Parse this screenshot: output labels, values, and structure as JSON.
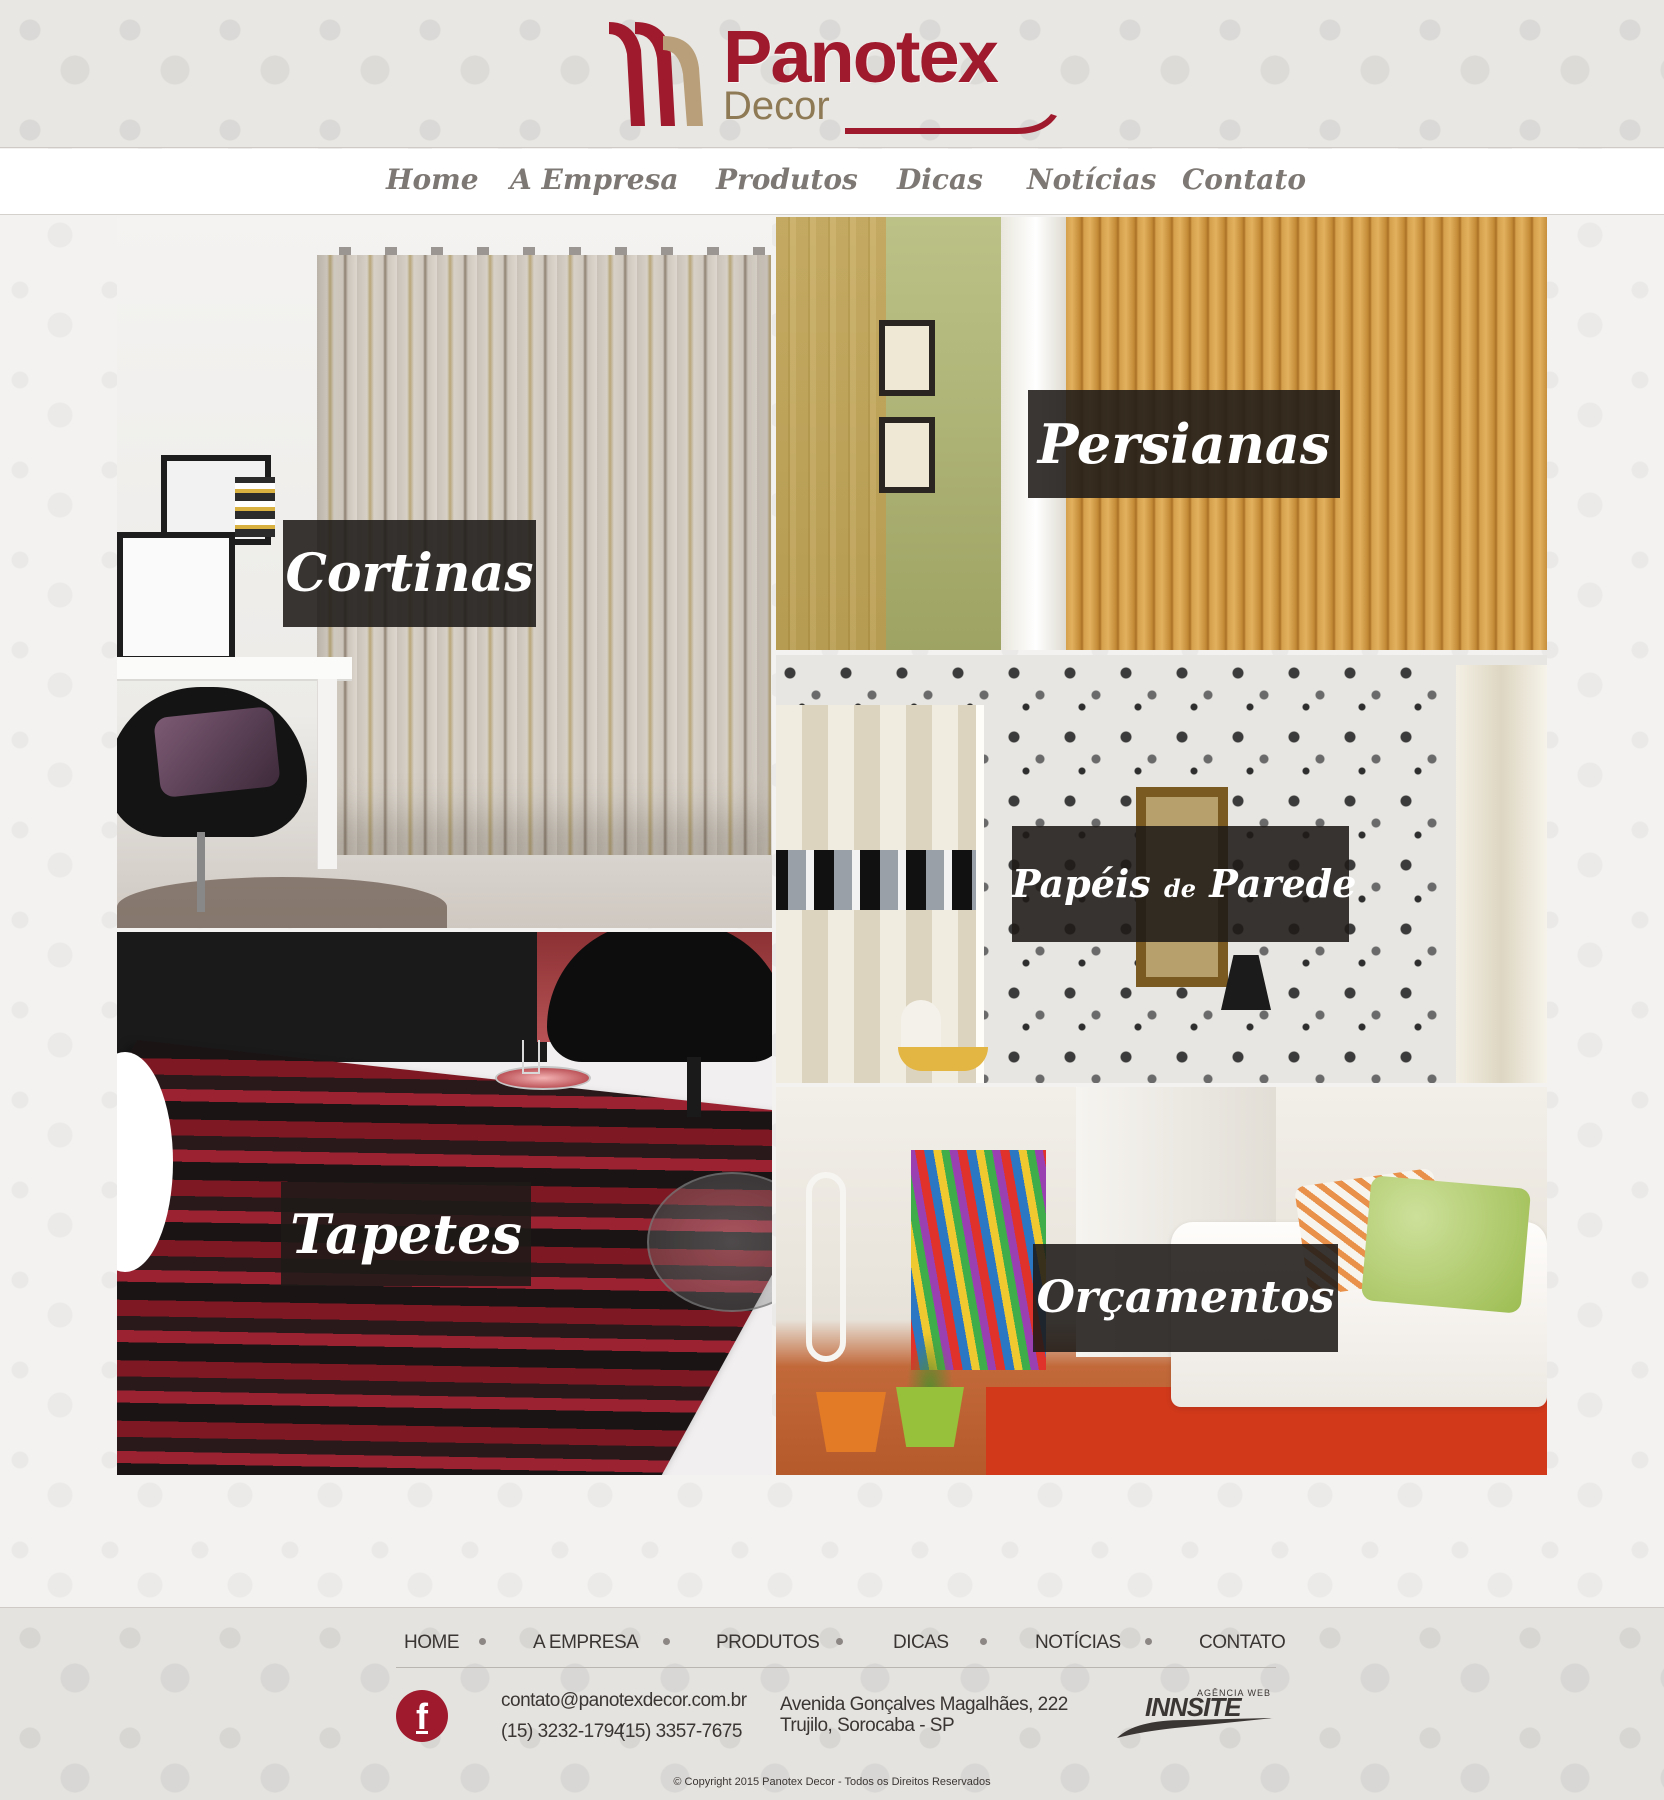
{
  "brand": {
    "name": "Panotex",
    "sub": "Decor",
    "colors": {
      "primary": "#a01a2d",
      "gold": "#8f7a56",
      "nav_text": "#7e7874"
    }
  },
  "nav": {
    "items": [
      "Home",
      "A Empresa",
      "Produtos",
      "Dicas",
      "Notícias",
      "Contato"
    ]
  },
  "tiles": {
    "cortinas": "Cortinas",
    "persianas": "Persianas",
    "papeis_a": "Papéis",
    "papeis_de": "de",
    "papeis_b": "Parede",
    "tapetes": "Tapetes",
    "orcamentos": "Orçamentos"
  },
  "footer": {
    "nav": [
      "HOME",
      "A EMPRESA",
      "PRODUTOS",
      "DICAS",
      "NOTÍCIAS",
      "CONTATO"
    ],
    "facebook_icon": "facebook-icon",
    "email": "contato@panotexdecor.com.br",
    "phone1": "(15) 3232-1794",
    "phone2": "(15) 3357-7675",
    "address1": "Avenida Gonçalves Magalhães, 222",
    "address2": "Trujilo, Sorocaba - SP",
    "agency_tag": "AGÊNCIA WEB",
    "agency_name": "INNSITE",
    "copyright": "© Copyright 2015 Panotex Decor - Todos os Direitos Reservados"
  }
}
